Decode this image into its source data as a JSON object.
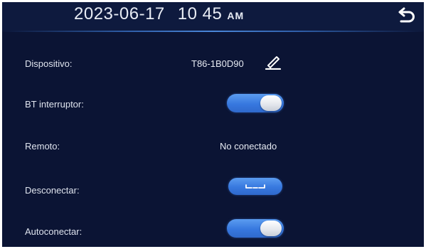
{
  "header": {
    "date": "2023-06-17",
    "time": "10 45",
    "ampm": "AM",
    "back_icon": "back-arrow-icon"
  },
  "settings": {
    "device": {
      "label": "Dispositivo:",
      "value": "T86-1B0D90",
      "edit_icon": "pencil-icon"
    },
    "bt_switch": {
      "label": "BT interruptor:",
      "state": "on"
    },
    "remote": {
      "label": "Remoto:",
      "value": "No conectado"
    },
    "disconnect": {
      "label": "Desconectar:",
      "button_icon": "disconnect-icon"
    },
    "autoconnect": {
      "label": "Autoconectar:",
      "state": "on"
    }
  },
  "colors": {
    "background": "#0b1434",
    "accent": "#3778df",
    "text": "#dfe4ee"
  }
}
